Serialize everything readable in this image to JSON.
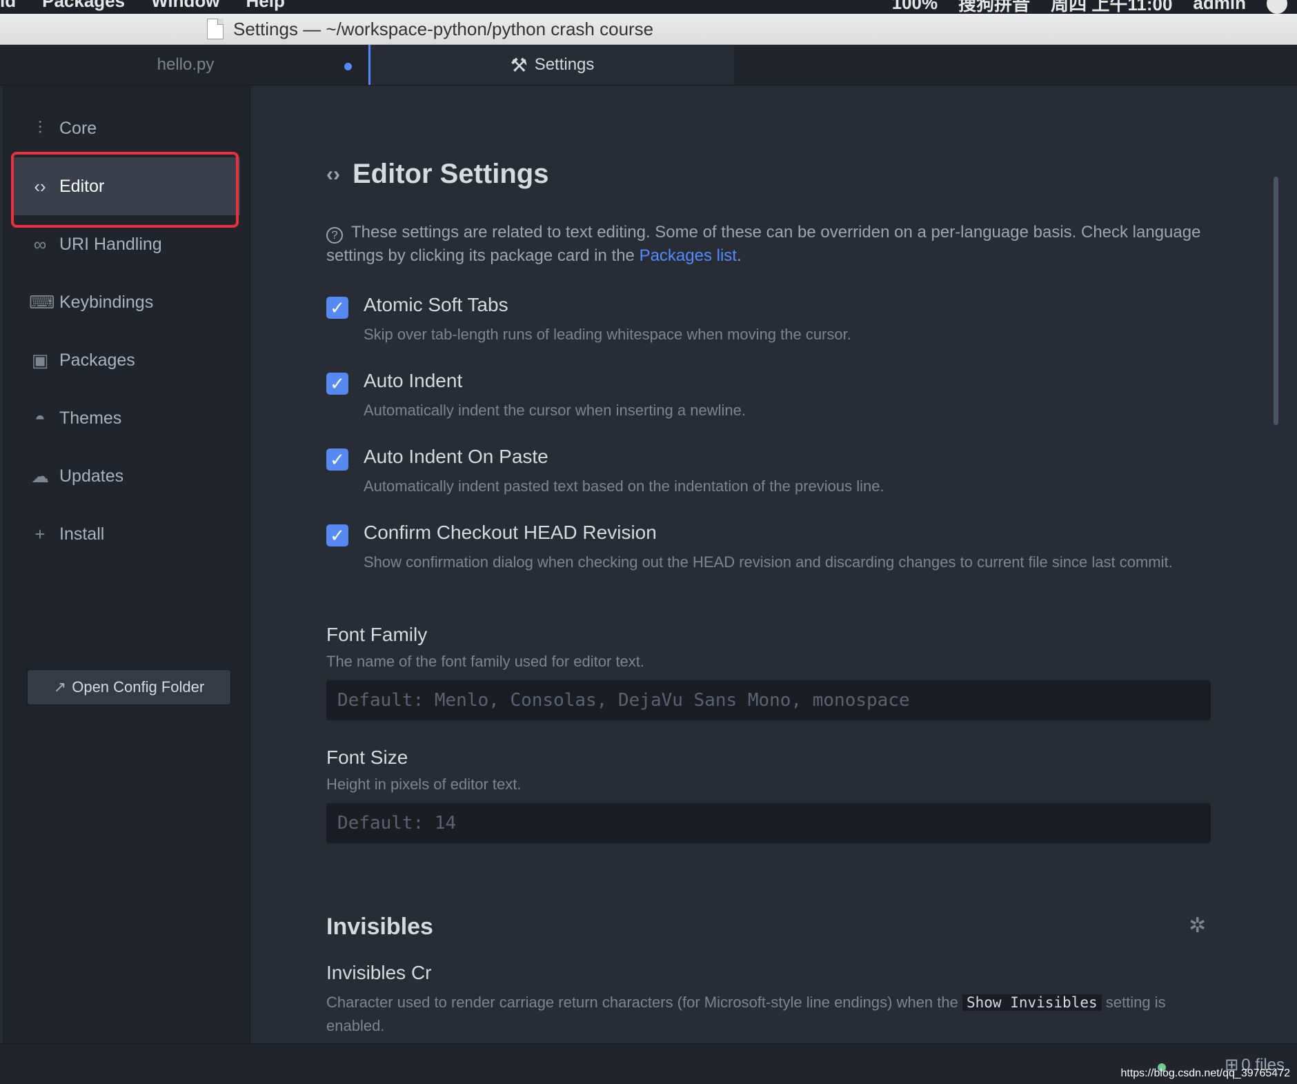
{
  "menubar": {
    "items": [
      "id",
      "Packages",
      "Window",
      "Help"
    ],
    "right": [
      "100%",
      "搜狗拼音",
      "周四 上午11:00",
      "admin"
    ]
  },
  "window": {
    "title": "Settings — ~/workspace-python/python crash course"
  },
  "tabs": [
    {
      "label": "hello.py",
      "modified": true
    },
    {
      "label": "Settings",
      "icon": "tools-icon"
    }
  ],
  "sidebar": {
    "items": [
      {
        "label": "Core",
        "icon": "sliders-icon"
      },
      {
        "label": "Editor",
        "icon": "code-icon",
        "selected": true
      },
      {
        "label": "URI Handling",
        "icon": "link-icon"
      },
      {
        "label": "Keybindings",
        "icon": "keyboard-icon"
      },
      {
        "label": "Packages",
        "icon": "package-icon"
      },
      {
        "label": "Themes",
        "icon": "paintcan-icon"
      },
      {
        "label": "Updates",
        "icon": "cloud-download-icon"
      },
      {
        "label": "Install",
        "icon": "plus-icon"
      }
    ],
    "open_config": "Open Config Folder"
  },
  "editor": {
    "title": "Editor Settings",
    "intro_text": "These settings are related to text editing. Some of these can be overriden on a per-language basis. Check language settings by clicking its package card in the",
    "intro_link": "Packages list",
    "intro_end": ".",
    "checkboxes": [
      {
        "label": "Atomic Soft Tabs",
        "desc": "Skip over tab-length runs of leading whitespace when moving the cursor.",
        "checked": true
      },
      {
        "label": "Auto Indent",
        "desc": "Automatically indent the cursor when inserting a newline.",
        "checked": true
      },
      {
        "label": "Auto Indent On Paste",
        "desc": "Automatically indent pasted text based on the indentation of the previous line.",
        "checked": true
      },
      {
        "label": "Confirm Checkout HEAD Revision",
        "desc": "Show confirmation dialog when checking out the HEAD revision and discarding changes to current file since last commit.",
        "checked": true
      }
    ],
    "font_family": {
      "label": "Font Family",
      "desc": "The name of the font family used for editor text.",
      "placeholder": "Default: Menlo, Consolas, DejaVu Sans Mono, monospace"
    },
    "font_size": {
      "label": "Font Size",
      "desc": "Height in pixels of editor text.",
      "placeholder": "Default: 14"
    },
    "invisibles": {
      "title": "Invisibles",
      "cr_label": "Invisibles Cr",
      "cr_desc_start": "Character used to render carriage return characters (for Microsoft-style line endings) when the",
      "cr_code": "Show Invisibles",
      "cr_desc_end": "setting is enabled."
    }
  },
  "statusbar": {
    "files": "0 files",
    "url": "https://blog.csdn.net/qq_39765472"
  },
  "colors": {
    "accent": "#568af2",
    "highlight": "#e8323f",
    "background": "#282c34"
  }
}
